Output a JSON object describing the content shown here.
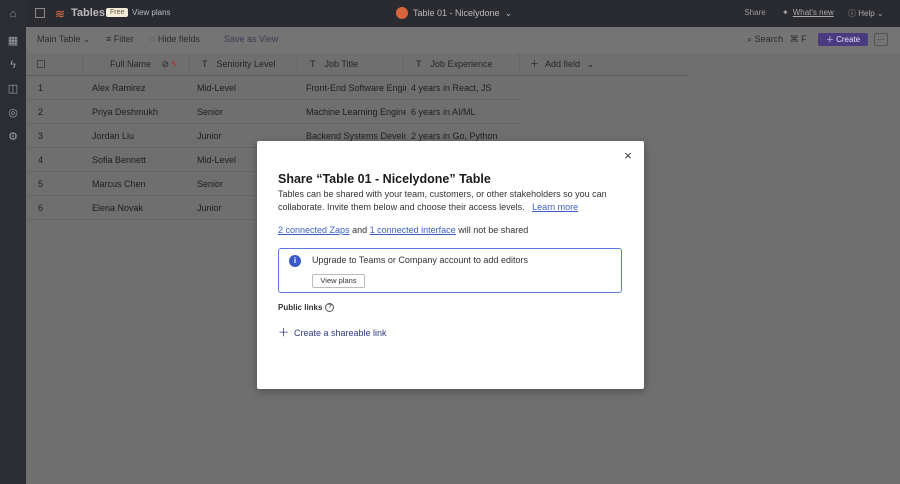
{
  "app": {
    "name": "Tables",
    "plan_badge": "Free",
    "view_plans": "View plans",
    "table_title": "Table 01 - Nicelydone",
    "share": "Share",
    "whats_new": "What's new",
    "help": "Help"
  },
  "toolbar": {
    "view_name": "Main Table",
    "filter": "Filter",
    "hide_fields": "Hide fields",
    "save_as_view": "Save as View",
    "search": "Search",
    "shortcut": "⌘ F",
    "create": "Create"
  },
  "table": {
    "columns": [
      "Full Name",
      "Seniority Level",
      "Job Title",
      "Job Experience"
    ],
    "add_field": "Add field",
    "rows": [
      {
        "num": "1",
        "name": "Alex Ramirez",
        "level": "Mid-Level",
        "title": "Front-End Software Engineer",
        "exp": "4 years in React, JS"
      },
      {
        "num": "2",
        "name": "Priya Deshmukh",
        "level": "Senior",
        "title": "Machine Learning Engineer",
        "exp": "6 years in AI/ML"
      },
      {
        "num": "3",
        "name": "Jordan Liu",
        "level": "Junior",
        "title": "Backend Systems Developer",
        "exp": "2 years in Go, Python"
      },
      {
        "num": "4",
        "name": "Sofia Bennett",
        "level": "Mid-Level",
        "title": "",
        "exp": ""
      },
      {
        "num": "5",
        "name": "Marcus Chen",
        "level": "Senior",
        "title": "",
        "exp": ""
      },
      {
        "num": "6",
        "name": "Elena Novak",
        "level": "Junior",
        "title": "",
        "exp": ""
      }
    ]
  },
  "modal": {
    "title": "Share “Table 01 - Nicelydone” Table",
    "desc": "Tables can be shared with your team, customers, or other stakeholders so you can collaborate. Invite them below and choose their access levels.",
    "learn_more": "Learn more",
    "zaps": "2 connected Zaps",
    "and": "and",
    "interface": "1 connected interface",
    "not_shared": "will not be shared",
    "upgrade_msg": "Upgrade to Teams or Company account to add editors",
    "view_plans": "View plans",
    "public_links": "Public links",
    "create_link": "Create a shareable link",
    "close": "×"
  }
}
